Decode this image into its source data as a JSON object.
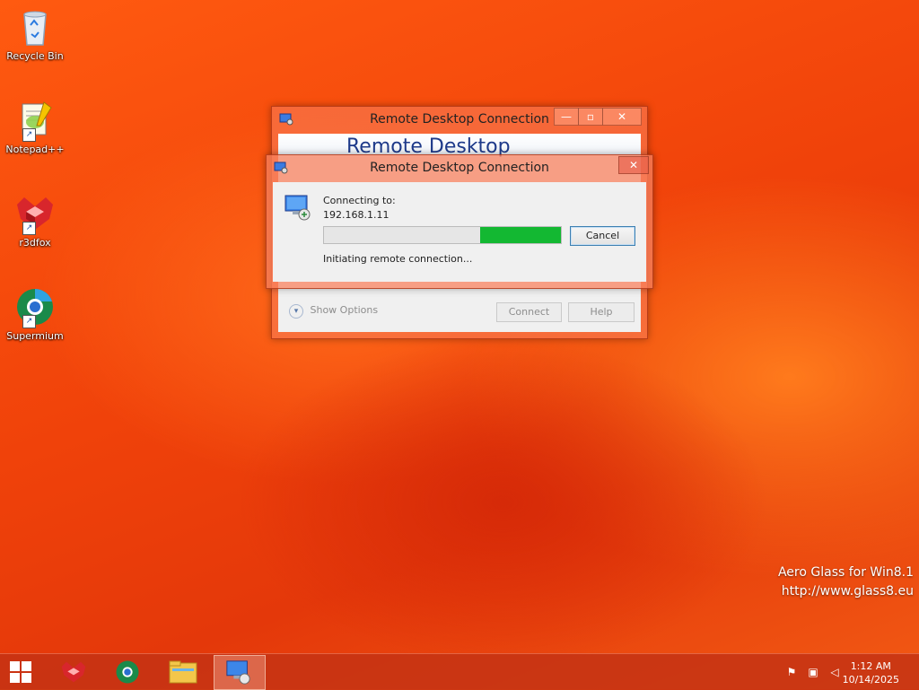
{
  "desktop": {
    "icons": [
      {
        "label": "Recycle Bin"
      },
      {
        "label": "Notepad++"
      },
      {
        "label": "r3dfox"
      },
      {
        "label": "Supermium"
      }
    ],
    "watermark": {
      "line1": "Aero Glass for Win8.1",
      "line2": "http://www.glass8.eu"
    }
  },
  "back_window": {
    "title": "Remote Desktop Connection",
    "banner_text": "Remote Desktop",
    "show_options": "Show Options",
    "connect_label": "Connect",
    "help_label": "Help"
  },
  "dialog": {
    "title": "Remote Desktop Connection",
    "connecting_to_label": "Connecting to:",
    "address": "192.168.1.11",
    "progress_fraction": 0.34,
    "cancel_label": "Cancel",
    "status": "Initiating remote connection..."
  },
  "taskbar": {
    "time": "1:12 AM",
    "date": "10/14/2025"
  },
  "colors": {
    "progress": "#13b832",
    "accent": "#f04a10"
  }
}
